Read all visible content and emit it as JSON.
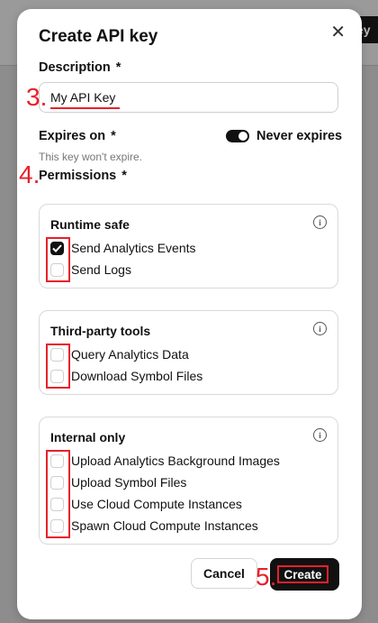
{
  "background": {
    "button_label": "ey"
  },
  "dialog": {
    "title": "Create API key",
    "description_label": "Description",
    "description_value": "My API Key",
    "required_marker": "*",
    "expires_label": "Expires on",
    "never_expires_label": "Never expires",
    "never_expires_on": true,
    "expires_hint": "This key won't expire.",
    "permissions_label": "Permissions",
    "cancel_label": "Cancel",
    "create_label": "Create"
  },
  "permission_groups": [
    {
      "title": "Runtime safe",
      "items": [
        {
          "label": "Send Analytics Events",
          "checked": true
        },
        {
          "label": "Send Logs",
          "checked": false
        }
      ]
    },
    {
      "title": "Third-party tools",
      "items": [
        {
          "label": "Query Analytics Data",
          "checked": false
        },
        {
          "label": "Download Symbol Files",
          "checked": false
        }
      ]
    },
    {
      "title": "Internal only",
      "items": [
        {
          "label": "Upload Analytics Background Images",
          "checked": false
        },
        {
          "label": "Upload Symbol Files",
          "checked": false
        },
        {
          "label": "Use Cloud Compute Instances",
          "checked": false
        },
        {
          "label": "Spawn Cloud Compute Instances",
          "checked": false
        }
      ]
    }
  ],
  "annotations": {
    "step3": "3.",
    "step4": "4.",
    "step5": "5."
  },
  "icons": {
    "close": "close-icon",
    "info": "info-icon",
    "check": "check-icon"
  },
  "colors": {
    "accent": "#111111",
    "annotation": "#e8202a"
  }
}
